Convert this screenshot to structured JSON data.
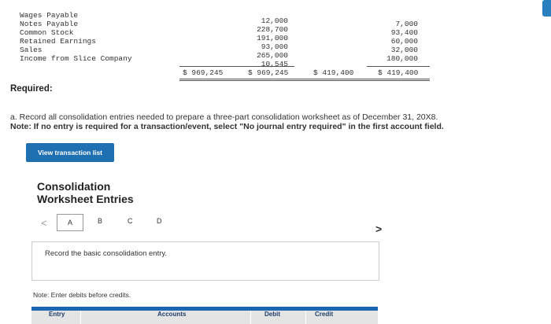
{
  "table": {
    "row_labels": [
      "Wages Payable",
      "Notes Payable",
      "Common Stock",
      "Retained Earnings",
      "Sales",
      "Income from Slice Company"
    ],
    "col_a": {
      "values": [
        "12,000",
        "228,700",
        "191,000",
        "93,000",
        "265,000",
        "10,545"
      ],
      "total": "$ 969,245"
    },
    "col_b": {
      "values": [
        "7,000",
        "93,400",
        "60,000",
        "32,000",
        "180,000"
      ],
      "total": "$ 419,400"
    },
    "debit_total": "$ 969,245",
    "credit_total": "$ 419,400"
  },
  "required_label": "Required:",
  "instructions": {
    "line1": "a. Record all consolidation entries needed to prepare a three-part consolidation worksheet as of December 31, 20X8.",
    "line2": "Note: If no entry is required for a transaction/event, select \"No journal entry required\" in the first account field."
  },
  "view_button_label": "View transaction list",
  "worksheet": {
    "title_line1": "Consolidation",
    "title_line2": "Worksheet Entries",
    "tabs": [
      "A",
      "B",
      "C",
      "D"
    ],
    "prev_chevron": "<",
    "next_chevron": ">",
    "record_prompt": "Record the basic consolidation entry.",
    "note": "Note: Enter debits before credits.",
    "grid_headers": [
      "Entry",
      "Accounts",
      "Debit",
      "Credit"
    ]
  },
  "colors": {
    "accent": "#1f6fb3",
    "grid_header_bg": "#e4e4e4"
  }
}
